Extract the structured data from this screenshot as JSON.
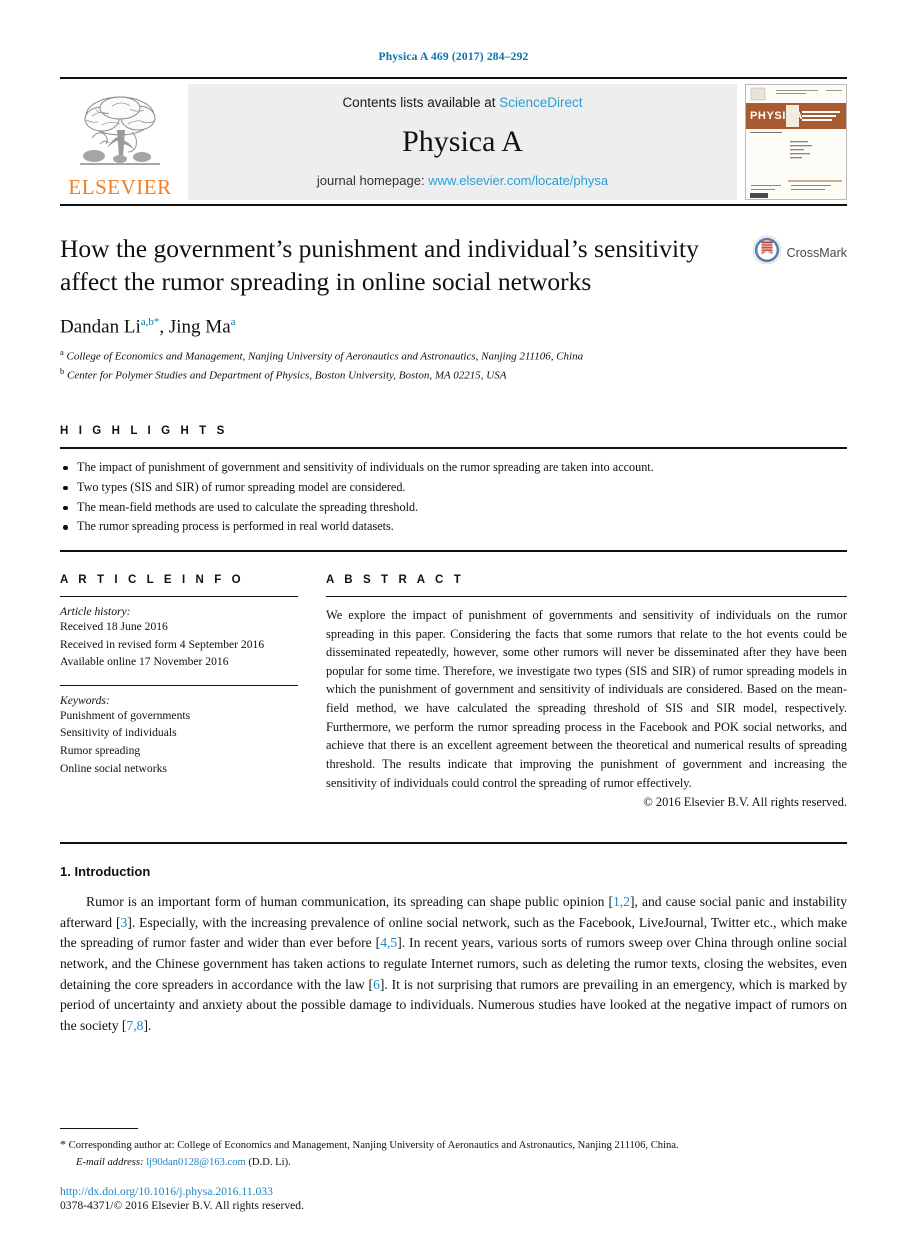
{
  "running_head": "Physica A 469 (2017) 284–292",
  "masthead": {
    "publisher_name": "ELSEVIER",
    "publisher_logo_icon": "elsevier-tree-logo",
    "contents_prefix": "Contents lists available at ",
    "contents_link": "ScienceDirect",
    "journal_title": "Physica A",
    "homepage_prefix": "journal homepage: ",
    "homepage_link": "www.elsevier.com/locate/physa",
    "cover_thumbnail_icon": "journal-cover-thumbnail",
    "cover_title": "PHYSICA",
    "cover_subtitle": "STATISTICAL MECHANICS AND ITS APPLICATIONS"
  },
  "article": {
    "title": "How the government’s punishment and individual’s sensitivity affect the rumor spreading in online social networks",
    "crossmark_label": "CrossMark",
    "crossmark_icon": "crossmark-logo",
    "authors": [
      {
        "name": "Dandan Li",
        "sup": "a,b",
        "star": "*"
      },
      {
        "name": "Jing Ma",
        "sup": "a",
        "star": ""
      }
    ],
    "affiliations": [
      {
        "marker": "a",
        "text": "College of Economics and Management, Nanjing University of Aeronautics and Astronautics, Nanjing 211106, China"
      },
      {
        "marker": "b",
        "text": "Center for Polymer Studies and Department of Physics, Boston University, Boston, MA 02215, USA"
      }
    ]
  },
  "highlights": {
    "heading": "H I G H L I G H T S",
    "items": [
      "The impact of punishment of government and sensitivity of individuals on the rumor spreading are taken into account.",
      "Two types (SIS and SIR) of rumor spreading model are considered.",
      "The mean-field methods are used to calculate the spreading threshold.",
      "The rumor spreading process is performed in real world datasets."
    ]
  },
  "article_info": {
    "heading": "A R T I C L E    I N F O",
    "history_label": "Article history:",
    "history": [
      "Received 18 June 2016",
      "Received in revised form 4 September 2016",
      "Available online 17 November 2016"
    ],
    "keywords_label": "Keywords:",
    "keywords": [
      "Punishment of governments",
      "Sensitivity of individuals",
      "Rumor spreading",
      "Online social networks"
    ]
  },
  "abstract": {
    "heading": "A B S T R A C T",
    "text": "We explore the impact of punishment of governments and sensitivity of individuals on the rumor spreading in this paper. Considering the facts that some rumors that relate to the hot events could be disseminated repeatedly, however, some other rumors will never be disseminated after they have been popular for some time. Therefore, we investigate two types (SIS and SIR) of rumor spreading models in which the punishment of government and sensitivity of individuals are considered. Based on the mean-field method, we have calculated the spreading threshold of SIS and SIR model, respectively. Furthermore, we perform the rumor spreading process in the Facebook and POK social networks, and achieve that there is an excellent agreement between the theoretical and numerical results of spreading threshold. The results indicate that improving the punishment of government and increasing the sensitivity of individuals could control the spreading of rumor effectively.",
    "copyright": "© 2016 Elsevier B.V. All rights reserved."
  },
  "introduction": {
    "heading": "1.  Introduction",
    "paragraph_parts": [
      {
        "type": "text",
        "value": "Rumor is an important form of human communication, its spreading can shape public opinion ["
      },
      {
        "type": "ref",
        "value": "1,2"
      },
      {
        "type": "text",
        "value": "], and cause social panic and instability afterward ["
      },
      {
        "type": "ref",
        "value": "3"
      },
      {
        "type": "text",
        "value": "]. Especially, with the increasing prevalence of online social network, such as the Facebook, LiveJournal, Twitter etc., which make the spreading of rumor faster and wider than ever before ["
      },
      {
        "type": "ref",
        "value": "4,5"
      },
      {
        "type": "text",
        "value": "]. In recent years, various sorts of rumors sweep over China through online social network, and the Chinese government has taken actions to regulate Internet rumors, such as deleting the rumor texts, closing the websites, even detaining the core spreaders in accordance with the law ["
      },
      {
        "type": "ref",
        "value": "6"
      },
      {
        "type": "text",
        "value": "]. It is not surprising that rumors are prevailing in an emergency, which is marked by period of uncertainty and anxiety about the possible damage to individuals. Numerous studies have looked at the negative impact of rumors on the society ["
      },
      {
        "type": "ref",
        "value": "7,8"
      },
      {
        "type": "text",
        "value": "]."
      }
    ]
  },
  "footnotes": {
    "corresponding_star": "*",
    "corresponding_text": "Corresponding author at: College of Economics and Management, Nanjing University of Aeronautics and Astronautics, Nanjing 211106, China.",
    "email_label": "E-mail address:",
    "email_value": "lj90dan0128@163.com",
    "email_attrib": "(D.D. Li).",
    "doi": "http://dx.doi.org/10.1016/j.physa.2016.11.033",
    "issn_line": "0378-4371/© 2016 Elsevier B.V. All rights reserved."
  },
  "colors": {
    "link_blue": "#2a9fd6",
    "ref_blue": "#1d86c4",
    "running_head_blue": "#0b72a8",
    "elsevier_orange": "#f07e26",
    "masthead_grey": "#eeeeee"
  }
}
